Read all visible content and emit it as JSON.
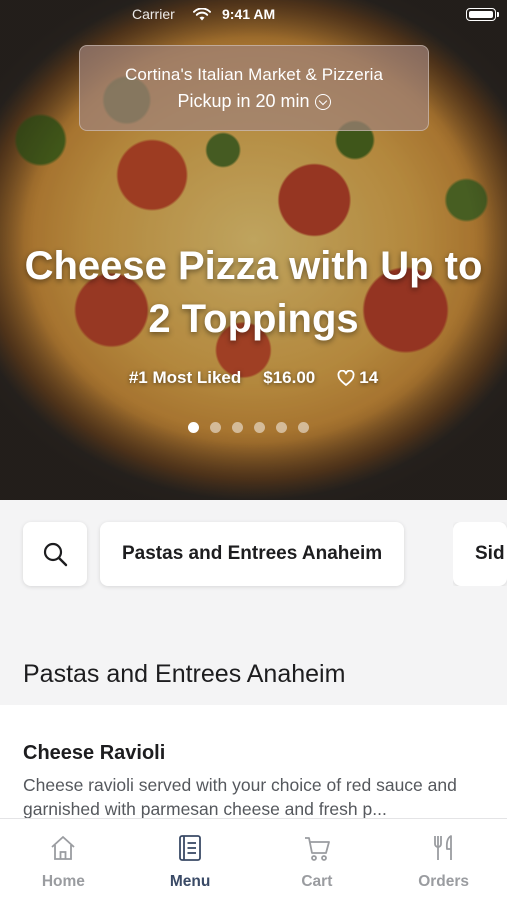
{
  "status_bar": {
    "carrier": "Carrier",
    "time": "9:41 AM"
  },
  "store": {
    "name": "Cortina's Italian Market & Pizzeria",
    "pickup": "Pickup in 20 min"
  },
  "featured": {
    "title": "Cheese Pizza with Up to 2 Toppings",
    "rank": "#1 Most Liked",
    "price": "$16.00",
    "likes": "14",
    "carousel_count": 6,
    "carousel_active": 1
  },
  "categories": {
    "search_icon": "search-icon",
    "chips": [
      "Pastas and Entrees Anaheim",
      "Sid"
    ]
  },
  "section": {
    "title": "Pastas and Entrees Anaheim"
  },
  "items": [
    {
      "name": "Cheese Ravioli",
      "description": "Cheese ravioli served with your choice of red sauce and garnished with parmesan cheese and fresh p..."
    }
  ],
  "tabs": [
    {
      "label": "Home",
      "icon": "home-icon",
      "active": false
    },
    {
      "label": "Menu",
      "icon": "menu-book-icon",
      "active": true
    },
    {
      "label": "Cart",
      "icon": "cart-icon",
      "active": false
    },
    {
      "label": "Orders",
      "icon": "fork-knife-icon",
      "active": false
    }
  ],
  "colors": {
    "active_tab": "#3a4a66",
    "inactive_tab": "#9a9ca0"
  }
}
